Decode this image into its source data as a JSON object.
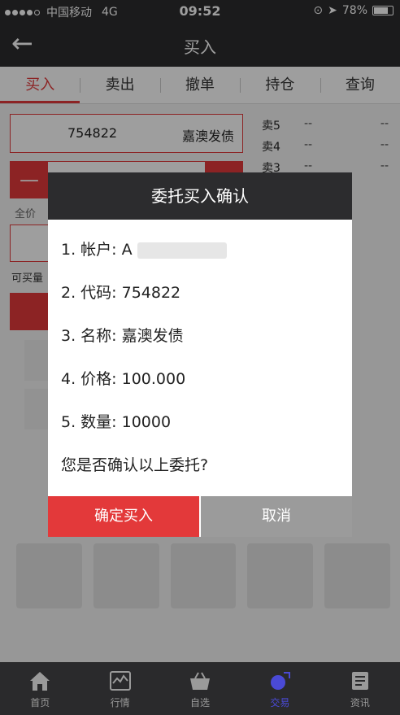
{
  "status_bar": {
    "carrier": "中国移动",
    "network": "4G",
    "time": "09:52",
    "battery": "78%",
    "battery_level": 0.78
  },
  "nav": {
    "title": "买入"
  },
  "tabs": [
    {
      "label": "买入",
      "active": true
    },
    {
      "label": "卖出",
      "active": false
    },
    {
      "label": "撤单",
      "active": false
    },
    {
      "label": "持仓",
      "active": false
    },
    {
      "label": "查询",
      "active": false
    }
  ],
  "form": {
    "code": "754822",
    "name": "嘉澳发债",
    "minus": "—",
    "full_price_label": "全价",
    "buyable_label": "可买量"
  },
  "quotes": [
    {
      "label": "卖5",
      "price": "--",
      "volume": "--"
    },
    {
      "label": "卖4",
      "price": "--",
      "volume": "--"
    },
    {
      "label": "卖3",
      "price": "--",
      "volume": "--"
    }
  ],
  "dialog": {
    "title": "委托买入确认",
    "account_label": "1. 帐户: A",
    "code_line": "2. 代码: 754822",
    "name_line": "3. 名称: 嘉澳发债",
    "price_line": "4. 价格: 100.000",
    "qty_line": "5. 数量: 10000",
    "question": "您是否确认以上委托?",
    "confirm_label": "确定买入",
    "cancel_label": "取消"
  },
  "bottom_tabs": [
    {
      "label": "首页",
      "icon": "home-icon"
    },
    {
      "label": "行情",
      "icon": "chart-icon"
    },
    {
      "label": "自选",
      "icon": "basket-icon"
    },
    {
      "label": "交易",
      "icon": "trade-icon",
      "active": true
    },
    {
      "label": "资讯",
      "icon": "news-icon"
    }
  ],
  "colors": {
    "accent": "#e3393a",
    "dark": "#2c2c2e",
    "cancel": "#9b9b9b",
    "active_tab": "#4a4ad6"
  }
}
